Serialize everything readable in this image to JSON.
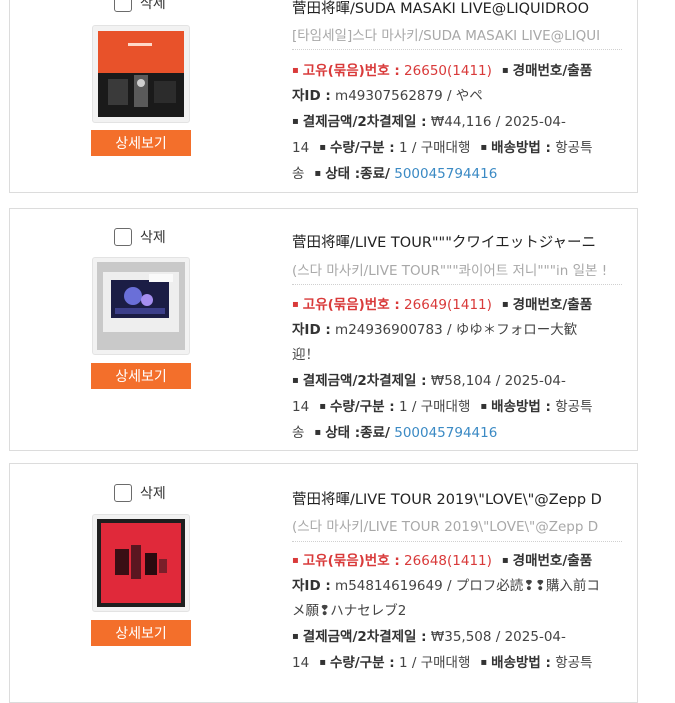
{
  "items": [
    {
      "delete_label": "삭제",
      "title": "菅田将暉/SUDA MASAKI LIVE@LIQUIDROO",
      "subtitle": "[타임세일]스다 마사키/SUDA MASAKI LIVE@LIQUI",
      "unique_label": "고유(묶음)번호 :",
      "unique_value": "26650(1411)",
      "auction_label": "경매번호/출품",
      "auction_label_cont": "자ID :",
      "auction_value": "m49307562879 / やペ",
      "auction_value_cont": "",
      "payment_label": "결제금액/2차결제일 :",
      "payment_value": "₩44,116 / 2025-04-",
      "payment_value_cont": "14",
      "qty_label": "수량/구분 :",
      "qty_value": "1 / 구매대행",
      "shipping_label": "배송방법 :",
      "shipping_value": "항공특",
      "shipping_value_cont": "송",
      "status_label": "상태 :",
      "status_value": "종료/",
      "tracking": "500045794416",
      "detail_button": "상세보기",
      "thumb_icon": "album-cover-orange"
    },
    {
      "delete_label": "삭제",
      "title": "菅田将暉/LIVE TOUR\"\"\"クワイエットジャーニ",
      "subtitle": "(스다 마사키/LIVE TOUR\"\"\"콰이어트 저니\"\"\"in 일본 !",
      "unique_label": "고유(묶음)번호 :",
      "unique_value": "26649(1411)",
      "auction_label": "경매번호/출품",
      "auction_label_cont": "자ID :",
      "auction_value": "m24936900783 / ゆゆ＊フォロー大歓",
      "auction_value_cont": "迎！",
      "payment_label": "결제금액/2차결제일 :",
      "payment_value": "₩58,104 / 2025-04-",
      "payment_value_cont": "14",
      "qty_label": "수량/구분 :",
      "qty_value": "1 / 구매대행",
      "shipping_label": "배송방법 :",
      "shipping_value": "항공특",
      "shipping_value_cont": "송",
      "status_label": "상태 :",
      "status_value": "종료/",
      "tracking": "500045794416",
      "detail_button": "상세보기",
      "thumb_icon": "blu-ray-cover-concert"
    },
    {
      "delete_label": "삭제",
      "title": "菅田将暉/LIVE TOUR 2019\\\"LOVE\\\"@Zepp D",
      "subtitle": "(스다 마사키/LIVE TOUR 2019\\\"LOVE\\\"@Zepp D",
      "unique_label": "고유(묶음)번호 :",
      "unique_value": "26648(1411)",
      "auction_label": "경매번호/출품",
      "auction_label_cont": "자ID :",
      "auction_value": "m54814619649 / プロフ必読❢❢購入前コ",
      "auction_value_cont": "メ願❢ハナセレブ2",
      "payment_label": "결제금액/2차결제일 :",
      "payment_value": "₩35,508 / 2025-04-",
      "payment_value_cont": "14",
      "qty_label": "수량/구분 :",
      "qty_value": "1 / 구매대행",
      "shipping_label": "배송방법 :",
      "shipping_value": "항공특",
      "shipping_value_cont": "",
      "status_label": "",
      "status_value": "",
      "tracking": "",
      "detail_button": "상세보기",
      "thumb_icon": "album-cover-red"
    }
  ],
  "colors": {
    "accent_button": "#f36f2b",
    "highlight_red": "#d93a3a",
    "link_blue": "#3b8ac4"
  }
}
